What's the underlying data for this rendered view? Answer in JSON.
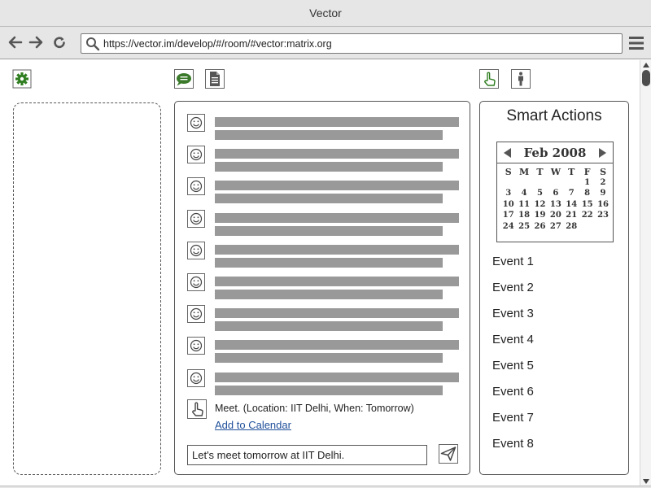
{
  "window": {
    "title": "Vector"
  },
  "browser": {
    "url": "https://vector.im/develop/#/room/#vector:matrix.org"
  },
  "icons": {
    "settings": "gear-icon",
    "chat": "chat-bubble-icon",
    "files": "document-icon",
    "smart_actions": "hand-pointer-icon",
    "members": "person-icon",
    "accent_green": "#3a7a2a"
  },
  "chat": {
    "message_count": 9,
    "smart_suggestion": {
      "text": "Meet. (Location: IIT Delhi, When: Tomorrow)",
      "link_label": "Add to Calendar"
    },
    "composer_value": "Let's meet tomorrow at IIT Delhi."
  },
  "smart_actions": {
    "title": "Smart Actions",
    "calendar": {
      "month_label": "Feb 2008",
      "weekdays": [
        "S",
        "M",
        "T",
        "W",
        "T",
        "F",
        "S"
      ],
      "weeks": [
        [
          "",
          "",
          "",
          "",
          "",
          "1",
          "2"
        ],
        [
          "3",
          "4",
          "5",
          "6",
          "7",
          "8",
          "9"
        ],
        [
          "10",
          "11",
          "12",
          "13",
          "14",
          "15",
          "16"
        ],
        [
          "17",
          "18",
          "19",
          "20",
          "21",
          "22",
          "23"
        ],
        [
          "24",
          "25",
          "26",
          "27",
          "28",
          "",
          ""
        ]
      ]
    },
    "events": [
      "Event 1",
      "Event 2",
      "Event 3",
      "Event 4",
      "Event 5",
      "Event 6",
      "Event 7",
      "Event 8"
    ]
  }
}
